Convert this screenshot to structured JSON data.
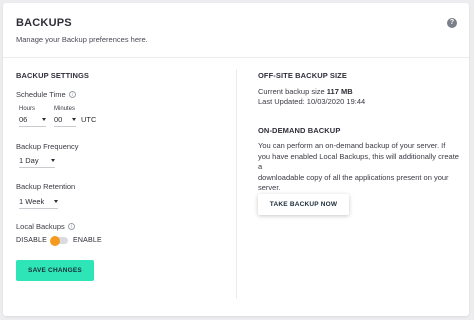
{
  "header": {
    "title": "BACKUPS",
    "subtitle": "Manage your Backup preferences here.",
    "help_icon": "question-icon"
  },
  "backup_settings": {
    "section_title": "BACKUP SETTINGS",
    "schedule_time": {
      "label": "Schedule Time",
      "hours_label": "Hours",
      "hours_value": "06",
      "minutes_label": "Minutes",
      "minutes_value": "00",
      "timezone": "UTC"
    },
    "frequency": {
      "label": "Backup Frequency",
      "value": "1 Day"
    },
    "retention": {
      "label": "Backup Retention",
      "value": "1 Week"
    },
    "local_backups": {
      "label": "Local Backups",
      "disable_label": "DISABLE",
      "enable_label": "ENABLE",
      "enabled": false,
      "toggle_color": "#f39a1f"
    },
    "save_label": "SAVE CHANGES",
    "save_color": "#2ee5b8"
  },
  "offsite": {
    "section_title": "OFF-SITE BACKUP SIZE",
    "current_size_label": "Current backup size",
    "current_size_value": "117 MB",
    "last_updated": "Last Updated: 10/03/2020 19:44"
  },
  "on_demand": {
    "section_title": "ON-DEMAND BACKUP",
    "description_lines": [
      "You can perform an on-demand backup of your server. If",
      "you have enabled Local Backups, this will additionally create a",
      "downloadable copy of all the applications present on your",
      "server."
    ],
    "button_label": "TAKE BACKUP NOW"
  }
}
